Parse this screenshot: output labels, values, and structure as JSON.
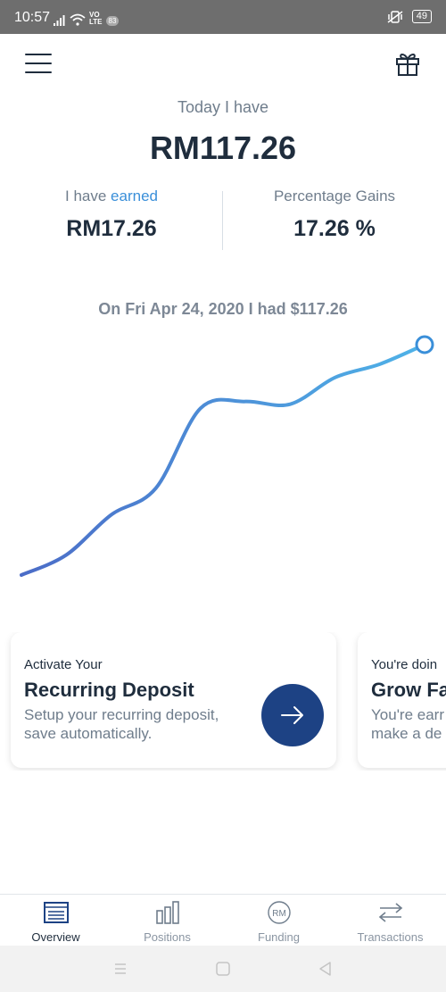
{
  "status_bar": {
    "time": "10:57",
    "network_label": "VO\nLTE",
    "badge": "83",
    "battery": "49"
  },
  "header": {
    "menu_icon": "hamburger-menu-icon",
    "gift_icon": "gift-icon"
  },
  "summary": {
    "today_label": "Today I have",
    "total_amount": "RM117.26",
    "earned_label_prefix": "I have ",
    "earned_label_accent": "earned",
    "earned_value": "RM17.26",
    "gains_label": "Percentage Gains",
    "gains_value": "17.26 %"
  },
  "history": {
    "text": "On Fri Apr 24, 2020 I had $117.26"
  },
  "colors": {
    "accent": "#3a8fd9",
    "primary_dark": "#1f2d3d",
    "button_navy": "#1d4284",
    "line_start": "#4b6cc7",
    "line_end": "#4fb3e8"
  },
  "chart_data": {
    "type": "line",
    "series": [
      {
        "values": [
          100,
          101.5,
          104.5,
          106.5,
          112.5,
          113,
          112.8,
          114.8,
          115.8,
          117.26
        ]
      }
    ],
    "highlight_last_point": true,
    "axes_visible": false,
    "grid": false
  },
  "cards": [
    {
      "kicker": "Activate Your",
      "title": "Recurring Deposit",
      "description": "Setup your recurring deposit,\nsave automatically.",
      "action_icon": "arrow-right-icon"
    },
    {
      "kicker": "You're doin",
      "title": "Grow Fa",
      "description": "You're earr\nmake a de"
    }
  ],
  "bottom_nav": [
    {
      "label": "Overview",
      "icon": "overview-icon",
      "active": true
    },
    {
      "label": "Positions",
      "icon": "bar-chart-icon",
      "active": false
    },
    {
      "label": "Funding",
      "icon": "rm-coin-icon",
      "icon_text": "RM",
      "active": false
    },
    {
      "label": "Transactions",
      "icon": "transfer-arrows-icon",
      "active": false
    }
  ],
  "system_nav": [
    "recents-icon",
    "home-icon",
    "back-icon"
  ]
}
